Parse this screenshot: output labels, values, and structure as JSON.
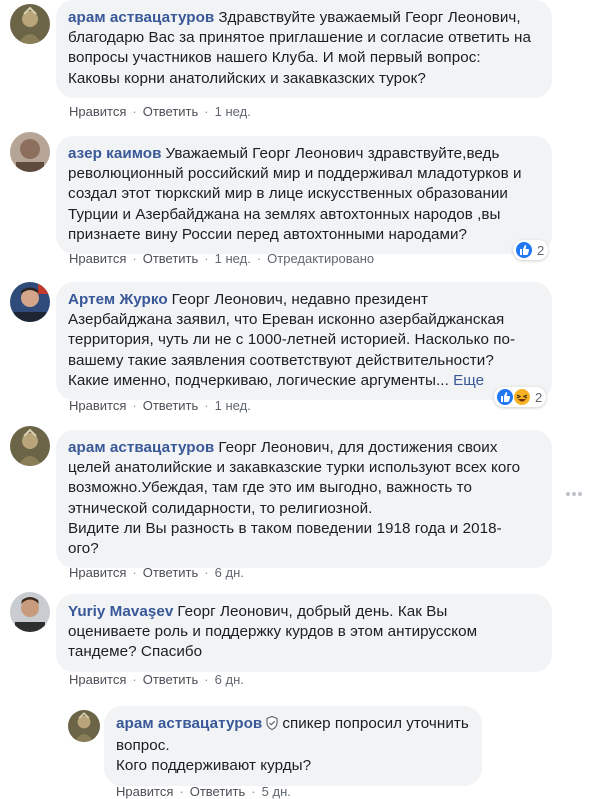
{
  "colors": {
    "bubble_bg": "#f2f3f5",
    "author_link": "#385898",
    "action_text": "#606770",
    "like_blue": "#2078f4",
    "haha_yellow": "#f7b125"
  },
  "comments": [
    {
      "author": "арам аствацатуров",
      "text": "Здравствуйте уважаемый Георг Леонович,\nблагодарю Вас за принятое приглашение и согласие ответить на\nвопросы участников нашего Клуба. И мой первый вопрос:\nКаковы корни анатолийских и закавказских турок?",
      "like_label": "Нравится",
      "reply_label": "Ответить",
      "time": "1 нед."
    },
    {
      "author": "азер каимов",
      "text": "Уважаемый Георг Леонович здравствуйте,ведь\nреволюционный российский мир и поддерживал младотурков и\nсоздал этот тюркский мир в лице искусственных образовании\nТурции и Азербайджана на землях автохтонных народов ,вы\nпризнаете вину России перед автохтонными народами?",
      "like_label": "Нравится",
      "reply_label": "Ответить",
      "time": "1 нед.",
      "edited": "Отредактировано",
      "reactions": {
        "icons": [
          "like-icon"
        ],
        "count": "2"
      }
    },
    {
      "author": "Артем Журко",
      "text": "Георг Леонович, недавно президент\nАзербайджана заявил, что Ереван исконно азербайджанская\nтерритория, чуть ли не с 1000-летней историей. Насколько по-\nвашему такие заявления соответствуют действительности?\nКакие именно, подчеркиваю, логические аргументы...",
      "more_label": "Еще",
      "like_label": "Нравится",
      "reply_label": "Ответить",
      "time": "1 нед.",
      "reactions": {
        "icons": [
          "like-icon",
          "haha-icon"
        ],
        "count": "2"
      }
    },
    {
      "author": "арам аствацатуров",
      "text": "Георг Леонович, для достижения своих\nцелей анатолийские и закавказские турки используют всех кого\nвозможно.Убеждая, там где это им выгодно, важность то\nэтнической солидарности, то религиозной.\nВидите ли Вы разность в таком поведении 1918 года и 2018-\nого?",
      "like_label": "Нравится",
      "reply_label": "Ответить",
      "time": "6 дн."
    },
    {
      "author": "Yuriy Mavaşev",
      "text": "Георг Леонович, добрый день. Как Вы\nоцениваете роль и поддержку курдов в этом антирусском\nтандеме? Спасибо",
      "like_label": "Нравится",
      "reply_label": "Ответить",
      "time": "6 дн."
    }
  ],
  "reply": {
    "author": "арам аствацатуров",
    "badge_icon": "shield-icon",
    "text": "спикер попросил уточнить\nвопрос.\nКого поддерживают курды?",
    "like_label": "Нравится",
    "reply_label": "Ответить",
    "time": "5 дн."
  },
  "menu_icon": "more-horizontal-icon"
}
